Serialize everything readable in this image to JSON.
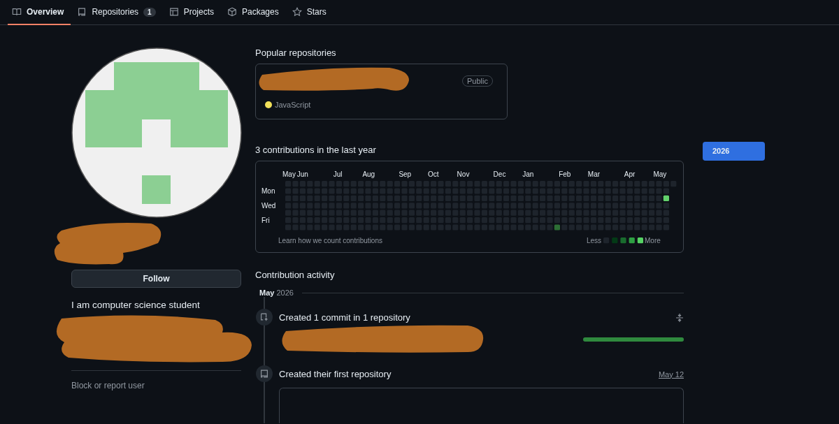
{
  "tabs": [
    {
      "label": "Overview",
      "selected": true
    },
    {
      "label": "Repositories",
      "count": "1",
      "selected": false
    },
    {
      "label": "Projects",
      "selected": false
    },
    {
      "label": "Packages",
      "selected": false
    },
    {
      "label": "Stars",
      "selected": false
    }
  ],
  "sidebar": {
    "follow_button": "Follow",
    "bio": "I am computer science student",
    "block_link": "Block or report user"
  },
  "popular": {
    "title": "Popular repositories",
    "repos": [
      {
        "visibility": "Public",
        "language": "JavaScript",
        "color": "#f1e05a"
      }
    ]
  },
  "contributions": {
    "title": "3 contributions in the last year",
    "months": [
      "May",
      "Jun",
      "Jul",
      "Aug",
      "Sep",
      "Oct",
      "Nov",
      "Dec",
      "Jan",
      "Feb",
      "Mar",
      "Apr",
      "May"
    ],
    "weekdays": [
      "Mon",
      "Wed",
      "Fri"
    ],
    "weeks": [
      [
        {
          "color": "#1e242c"
        },
        {
          "color": "#1e242c"
        },
        {
          "color": "#1e242c"
        },
        {
          "color": "#1e242c"
        },
        {
          "color": "#1e242c"
        },
        {
          "color": "#1e242c"
        },
        {
          "color": "#1e242c"
        }
      ],
      [
        {
          "color": "#1e242c"
        },
        {
          "color": "#1e242c"
        },
        {
          "color": "#1e242c"
        },
        {
          "color": "#1e242c"
        },
        {
          "color": "#1e242c"
        },
        {
          "color": "#1e242c"
        },
        {
          "color": "#1e242c"
        }
      ],
      [
        {
          "color": "#1e242c"
        },
        {
          "color": "#1e242c"
        },
        {
          "color": "#1e242c"
        },
        {
          "color": "#1e242c"
        },
        {
          "color": "#1e242c"
        },
        {
          "color": "#1e242c"
        },
        {
          "color": "#1e242c"
        }
      ],
      [
        {
          "color": "#1e242c"
        },
        {
          "color": "#1e242c"
        },
        {
          "color": "#1e242c"
        },
        {
          "color": "#1e242c"
        },
        {
          "color": "#1e242c"
        },
        {
          "color": "#1e242c"
        },
        {
          "color": "#1e242c"
        }
      ],
      [
        {
          "color": "#1e242c"
        },
        {
          "color": "#1e242c"
        },
        {
          "color": "#1e242c"
        },
        {
          "color": "#1e242c"
        },
        {
          "color": "#1e242c"
        },
        {
          "color": "#1e242c"
        },
        {
          "color": "#1e242c"
        }
      ],
      [
        {
          "color": "#1e242c"
        },
        {
          "color": "#1e242c"
        },
        {
          "color": "#1e242c"
        },
        {
          "color": "#1e242c"
        },
        {
          "color": "#1e242c"
        },
        {
          "color": "#1e242c"
        },
        {
          "color": "#1e242c"
        }
      ],
      [
        {
          "color": "#1e242c"
        },
        {
          "color": "#1e242c"
        },
        {
          "color": "#1e242c"
        },
        {
          "color": "#1e242c"
        },
        {
          "color": "#1e242c"
        },
        {
          "color": "#1e242c"
        },
        {
          "color": "#1e242c"
        }
      ],
      [
        {
          "color": "#1e242c"
        },
        {
          "color": "#1e242c"
        },
        {
          "color": "#1e242c"
        },
        {
          "color": "#1e242c"
        },
        {
          "color": "#1e242c"
        },
        {
          "color": "#1e242c"
        },
        {
          "color": "#1e242c"
        }
      ],
      [
        {
          "color": "#1e242c"
        },
        {
          "color": "#1e242c"
        },
        {
          "color": "#1e242c"
        },
        {
          "color": "#1e242c"
        },
        {
          "color": "#1e242c"
        },
        {
          "color": "#1e242c"
        },
        {
          "color": "#1e242c"
        }
      ],
      [
        {
          "color": "#1e242c"
        },
        {
          "color": "#1e242c"
        },
        {
          "color": "#1e242c"
        },
        {
          "color": "#1e242c"
        },
        {
          "color": "#1e242c"
        },
        {
          "color": "#1e242c"
        },
        {
          "color": "#1e242c"
        }
      ],
      [
        {
          "color": "#1e242c"
        },
        {
          "color": "#1e242c"
        },
        {
          "color": "#1e242c"
        },
        {
          "color": "#1e242c"
        },
        {
          "color": "#1e242c"
        },
        {
          "color": "#1e242c"
        },
        {
          "color": "#1e242c"
        }
      ],
      [
        {
          "color": "#1e242c"
        },
        {
          "color": "#1e242c"
        },
        {
          "color": "#1e242c"
        },
        {
          "color": "#1e242c"
        },
        {
          "color": "#1e242c"
        },
        {
          "color": "#1e242c"
        },
        {
          "color": "#1e242c"
        }
      ],
      [
        {
          "color": "#1e242c"
        },
        {
          "color": "#1e242c"
        },
        {
          "color": "#1e242c"
        },
        {
          "color": "#1e242c"
        },
        {
          "color": "#1e242c"
        },
        {
          "color": "#1e242c"
        },
        {
          "color": "#1e242c"
        }
      ],
      [
        {
          "color": "#1e242c"
        },
        {
          "color": "#1e242c"
        },
        {
          "color": "#1e242c"
        },
        {
          "color": "#1e242c"
        },
        {
          "color": "#1e242c"
        },
        {
          "color": "#1e242c"
        },
        {
          "color": "#1e242c"
        }
      ],
      [
        {
          "color": "#1e242c"
        },
        {
          "color": "#1e242c"
        },
        {
          "color": "#1e242c"
        },
        {
          "color": "#1e242c"
        },
        {
          "color": "#1e242c"
        },
        {
          "color": "#1e242c"
        },
        {
          "color": "#1e242c"
        }
      ],
      [
        {
          "color": "#1e242c"
        },
        {
          "color": "#1e242c"
        },
        {
          "color": "#1e242c"
        },
        {
          "color": "#1e242c"
        },
        {
          "color": "#1e242c"
        },
        {
          "color": "#1e242c"
        },
        {
          "color": "#1e242c"
        }
      ],
      [
        {
          "color": "#1e242c"
        },
        {
          "color": "#1e242c"
        },
        {
          "color": "#1e242c"
        },
        {
          "color": "#1e242c"
        },
        {
          "color": "#1e242c"
        },
        {
          "color": "#1e242c"
        },
        {
          "color": "#1e242c"
        }
      ],
      [
        {
          "color": "#1e242c"
        },
        {
          "color": "#1e242c"
        },
        {
          "color": "#1e242c"
        },
        {
          "color": "#1e242c"
        },
        {
          "color": "#1e242c"
        },
        {
          "color": "#1e242c"
        },
        {
          "color": "#1e242c"
        }
      ],
      [
        {
          "color": "#1e242c"
        },
        {
          "color": "#1e242c"
        },
        {
          "color": "#1e242c"
        },
        {
          "color": "#1e242c"
        },
        {
          "color": "#1e242c"
        },
        {
          "color": "#1e242c"
        },
        {
          "color": "#1e242c"
        }
      ],
      [
        {
          "color": "#1e242c"
        },
        {
          "color": "#1e242c"
        },
        {
          "color": "#1e242c"
        },
        {
          "color": "#1e242c"
        },
        {
          "color": "#1e242c"
        },
        {
          "color": "#1e242c"
        },
        {
          "color": "#1e242c"
        }
      ],
      [
        {
          "color": "#1e242c"
        },
        {
          "color": "#1e242c"
        },
        {
          "color": "#1e242c"
        },
        {
          "color": "#1e242c"
        },
        {
          "color": "#1e242c"
        },
        {
          "color": "#1e242c"
        },
        {
          "color": "#1e242c"
        }
      ],
      [
        {
          "color": "#1e242c"
        },
        {
          "color": "#1e242c"
        },
        {
          "color": "#1e242c"
        },
        {
          "color": "#1e242c"
        },
        {
          "color": "#1e242c"
        },
        {
          "color": "#1e242c"
        },
        {
          "color": "#1e242c"
        }
      ],
      [
        {
          "color": "#1e242c"
        },
        {
          "color": "#1e242c"
        },
        {
          "color": "#1e242c"
        },
        {
          "color": "#1e242c"
        },
        {
          "color": "#1e242c"
        },
        {
          "color": "#1e242c"
        },
        {
          "color": "#1e242c"
        }
      ],
      [
        {
          "color": "#1e242c"
        },
        {
          "color": "#1e242c"
        },
        {
          "color": "#1e242c"
        },
        {
          "color": "#1e242c"
        },
        {
          "color": "#1e242c"
        },
        {
          "color": "#1e242c"
        },
        {
          "color": "#1e242c"
        }
      ],
      [
        {
          "color": "#1e242c"
        },
        {
          "color": "#1e242c"
        },
        {
          "color": "#1e242c"
        },
        {
          "color": "#1e242c"
        },
        {
          "color": "#1e242c"
        },
        {
          "color": "#1e242c"
        },
        {
          "color": "#1e242c"
        }
      ],
      [
        {
          "color": "#1e242c"
        },
        {
          "color": "#1e242c"
        },
        {
          "color": "#1e242c"
        },
        {
          "color": "#1e242c"
        },
        {
          "color": "#1e242c"
        },
        {
          "color": "#1e242c"
        },
        {
          "color": "#1e242c"
        }
      ],
      [
        {
          "color": "#1e242c"
        },
        {
          "color": "#1e242c"
        },
        {
          "color": "#1e242c"
        },
        {
          "color": "#1e242c"
        },
        {
          "color": "#1e242c"
        },
        {
          "color": "#1e242c"
        },
        {
          "color": "#1e242c"
        }
      ],
      [
        {
          "color": "#1e242c"
        },
        {
          "color": "#1e242c"
        },
        {
          "color": "#1e242c"
        },
        {
          "color": "#1e242c"
        },
        {
          "color": "#1e242c"
        },
        {
          "color": "#1e242c"
        },
        {
          "color": "#1e242c"
        }
      ],
      [
        {
          "color": "#1e242c"
        },
        {
          "color": "#1e242c"
        },
        {
          "color": "#1e242c"
        },
        {
          "color": "#1e242c"
        },
        {
          "color": "#1e242c"
        },
        {
          "color": "#1e242c"
        },
        {
          "color": "#1e242c"
        }
      ],
      [
        {
          "color": "#1e242c"
        },
        {
          "color": "#1e242c"
        },
        {
          "color": "#1e242c"
        },
        {
          "color": "#1e242c"
        },
        {
          "color": "#1e242c"
        },
        {
          "color": "#1e242c"
        },
        {
          "color": "#1e242c"
        }
      ],
      [
        {
          "color": "#1e242c"
        },
        {
          "color": "#1e242c"
        },
        {
          "color": "#1e242c"
        },
        {
          "color": "#1e242c"
        },
        {
          "color": "#1e242c"
        },
        {
          "color": "#1e242c"
        },
        {
          "color": "#1e242c"
        }
      ],
      [
        {
          "color": "#1e242c"
        },
        {
          "color": "#1e242c"
        },
        {
          "color": "#1e242c"
        },
        {
          "color": "#1e242c"
        },
        {
          "color": "#1e242c"
        },
        {
          "color": "#1e242c"
        },
        {
          "color": "#1e242c"
        }
      ],
      [
        {
          "color": "#1e242c"
        },
        {
          "color": "#1e242c"
        },
        {
          "color": "#1e242c"
        },
        {
          "color": "#1e242c"
        },
        {
          "color": "#1e242c"
        },
        {
          "color": "#1e242c"
        },
        {
          "color": "#1e242c"
        }
      ],
      [
        {
          "color": "#1e242c"
        },
        {
          "color": "#1e242c"
        },
        {
          "color": "#1e242c"
        },
        {
          "color": "#1e242c"
        },
        {
          "color": "#1e242c"
        },
        {
          "color": "#1e242c"
        },
        {
          "color": "#1e242c"
        }
      ],
      [
        {
          "color": "#1e242c"
        },
        {
          "color": "#1e242c"
        },
        {
          "color": "#1e242c"
        },
        {
          "color": "#1e242c"
        },
        {
          "color": "#1e242c"
        },
        {
          "color": "#1e242c"
        },
        {
          "color": "#1e242c"
        }
      ],
      [
        {
          "color": "#1e242c"
        },
        {
          "color": "#1e242c"
        },
        {
          "color": "#1e242c"
        },
        {
          "color": "#1e242c"
        },
        {
          "color": "#1e242c"
        },
        {
          "color": "#1e242c"
        },
        {
          "color": "#1e242c"
        }
      ],
      [
        {
          "color": "#1e242c"
        },
        {
          "color": "#1e242c"
        },
        {
          "color": "#1e242c"
        },
        {
          "color": "#1e242c"
        },
        {
          "color": "#1e242c"
        },
        {
          "color": "#1e242c"
        },
        {
          "color": "#1e242c"
        }
      ],
      [
        {
          "color": "#1e242c"
        },
        {
          "color": "#1e242c"
        },
        {
          "color": "#1e242c"
        },
        {
          "color": "#1e242c"
        },
        {
          "color": "#1e242c"
        },
        {
          "color": "#1e242c"
        },
        {
          "color": "#2d6f35"
        }
      ],
      [
        {
          "color": "#1e242c"
        },
        {
          "color": "#1e242c"
        },
        {
          "color": "#1e242c"
        },
        {
          "color": "#1e242c"
        },
        {
          "color": "#1e242c"
        },
        {
          "color": "#1e242c"
        },
        {
          "color": "#1e242c"
        }
      ],
      [
        {
          "color": "#1e242c"
        },
        {
          "color": "#1e242c"
        },
        {
          "color": "#1e242c"
        },
        {
          "color": "#1e242c"
        },
        {
          "color": "#1e242c"
        },
        {
          "color": "#1e242c"
        },
        {
          "color": "#1e242c"
        }
      ],
      [
        {
          "color": "#1e242c"
        },
        {
          "color": "#1e242c"
        },
        {
          "color": "#1e242c"
        },
        {
          "color": "#1e242c"
        },
        {
          "color": "#1e242c"
        },
        {
          "color": "#1e242c"
        },
        {
          "color": "#1e242c"
        }
      ],
      [
        {
          "color": "#1e242c"
        },
        {
          "color": "#1e242c"
        },
        {
          "color": "#1e242c"
        },
        {
          "color": "#1e242c"
        },
        {
          "color": "#1e242c"
        },
        {
          "color": "#1e242c"
        },
        {
          "color": "#1e242c"
        }
      ],
      [
        {
          "color": "#1e242c"
        },
        {
          "color": "#1e242c"
        },
        {
          "color": "#1e242c"
        },
        {
          "color": "#1e242c"
        },
        {
          "color": "#1e242c"
        },
        {
          "color": "#1e242c"
        },
        {
          "color": "#1e242c"
        }
      ],
      [
        {
          "color": "#1e242c"
        },
        {
          "color": "#1e242c"
        },
        {
          "color": "#1e242c"
        },
        {
          "color": "#1e242c"
        },
        {
          "color": "#1e242c"
        },
        {
          "color": "#1e242c"
        },
        {
          "color": "#1e242c"
        }
      ],
      [
        {
          "color": "#1e242c"
        },
        {
          "color": "#1e242c"
        },
        {
          "color": "#1e242c"
        },
        {
          "color": "#1e242c"
        },
        {
          "color": "#1e242c"
        },
        {
          "color": "#1e242c"
        },
        {
          "color": "#1e242c"
        }
      ],
      [
        {
          "color": "#1e242c"
        },
        {
          "color": "#1e242c"
        },
        {
          "color": "#1e242c"
        },
        {
          "color": "#1e242c"
        },
        {
          "color": "#1e242c"
        },
        {
          "color": "#1e242c"
        },
        {
          "color": "#1e242c"
        }
      ],
      [
        {
          "color": "#1e242c"
        },
        {
          "color": "#1e242c"
        },
        {
          "color": "#1e242c"
        },
        {
          "color": "#1e242c"
        },
        {
          "color": "#1e242c"
        },
        {
          "color": "#1e242c"
        },
        {
          "color": "#1e242c"
        }
      ],
      [
        {
          "color": "#1e242c"
        },
        {
          "color": "#1e242c"
        },
        {
          "color": "#1e242c"
        },
        {
          "color": "#1e242c"
        },
        {
          "color": "#1e242c"
        },
        {
          "color": "#1e242c"
        },
        {
          "color": "#1e242c"
        }
      ],
      [
        {
          "color": "#1e242c"
        },
        {
          "color": "#1e242c"
        },
        {
          "color": "#1e242c"
        },
        {
          "color": "#1e242c"
        },
        {
          "color": "#1e242c"
        },
        {
          "color": "#1e242c"
        },
        {
          "color": "#1e242c"
        }
      ],
      [
        {
          "color": "#1e242c"
        },
        {
          "color": "#1e242c"
        },
        {
          "color": "#1e242c"
        },
        {
          "color": "#1e242c"
        },
        {
          "color": "#1e242c"
        },
        {
          "color": "#1e242c"
        },
        {
          "color": "#1e242c"
        }
      ],
      [
        {
          "color": "#1e242c"
        },
        {
          "color": "#1e242c"
        },
        {
          "color": "#1e242c"
        },
        {
          "color": "#1e242c"
        },
        {
          "color": "#1e242c"
        },
        {
          "color": "#1e242c"
        },
        {
          "color": "#1e242c"
        }
      ],
      [
        {
          "color": "#1e242c"
        },
        {
          "color": "#1e242c"
        },
        {
          "color": "#1e242c"
        },
        {
          "color": "#1e242c"
        },
        {
          "color": "#1e242c"
        },
        {
          "color": "#1e242c"
        },
        {
          "color": "#1e242c"
        }
      ],
      [
        {
          "color": "#1e242c"
        },
        {
          "color": "#1e242c"
        },
        {
          "color": "#63d26c"
        },
        {
          "color": "#1e242c"
        },
        {
          "color": "#1e242c"
        },
        {
          "color": "#1e242c"
        },
        {
          "color": "#1e242c"
        }
      ],
      [
        {
          "color": "#1e242c"
        }
      ]
    ],
    "learn_link": "Learn how we count contributions",
    "less": "Less",
    "more": "More"
  },
  "years": [
    {
      "label": "2026",
      "selected": true
    }
  ],
  "activity": {
    "title": "Contribution activity",
    "month": "**May** 2026",
    "items": [
      {
        "kind": "commits",
        "title": "Created 1 commit in 1 repository",
        "level": 1
      },
      {
        "kind": "repo",
        "title": "Created their first repository",
        "date": "May 12"
      }
    ]
  }
}
